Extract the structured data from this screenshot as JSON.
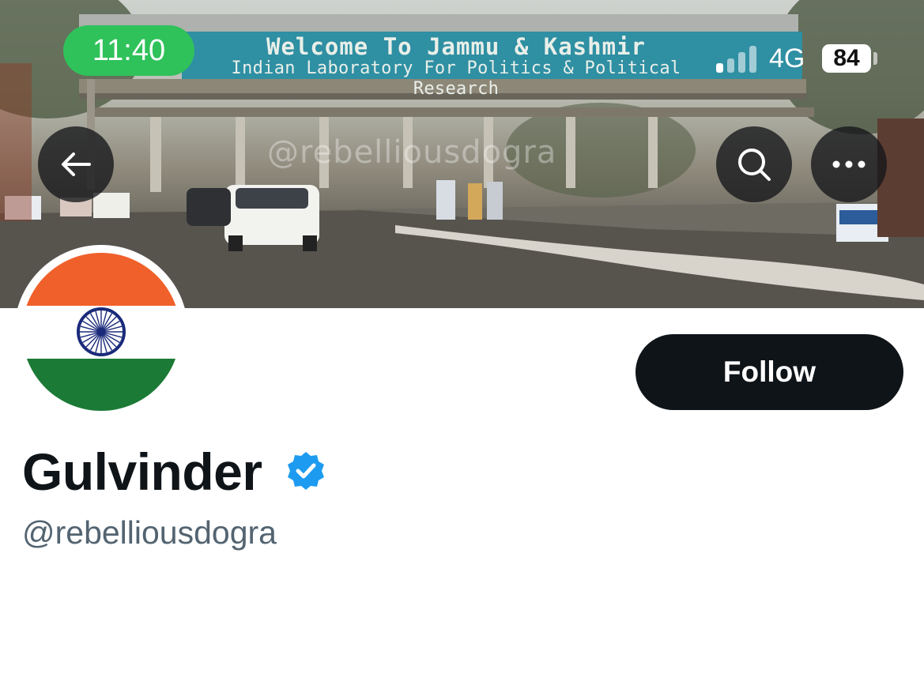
{
  "status_bar": {
    "time": "11:40",
    "network": "4G",
    "battery": "84"
  },
  "banner": {
    "sign_line1": "Welcome To Jammu & Kashmir",
    "sign_line2": "Indian Laboratory For Politics & Political Research",
    "watermark": "@rebelliousdogra"
  },
  "nav": {
    "back_icon": "arrow-left-icon",
    "search_icon": "search-icon",
    "more_icon": "more-horizontal-icon"
  },
  "profile": {
    "display_name": "Gulvinder",
    "handle": "@rebelliousdogra",
    "verified": true,
    "follow_label": "Follow",
    "avatar": "india-flag"
  },
  "colors": {
    "follow_bg": "#0f1419",
    "verified_blue": "#1d9bf0",
    "handle_gray": "#536471",
    "time_pill": "#2fc25a",
    "saffron": "#f0602a",
    "green": "#1b7a35",
    "chakra": "#1a2a7a"
  }
}
